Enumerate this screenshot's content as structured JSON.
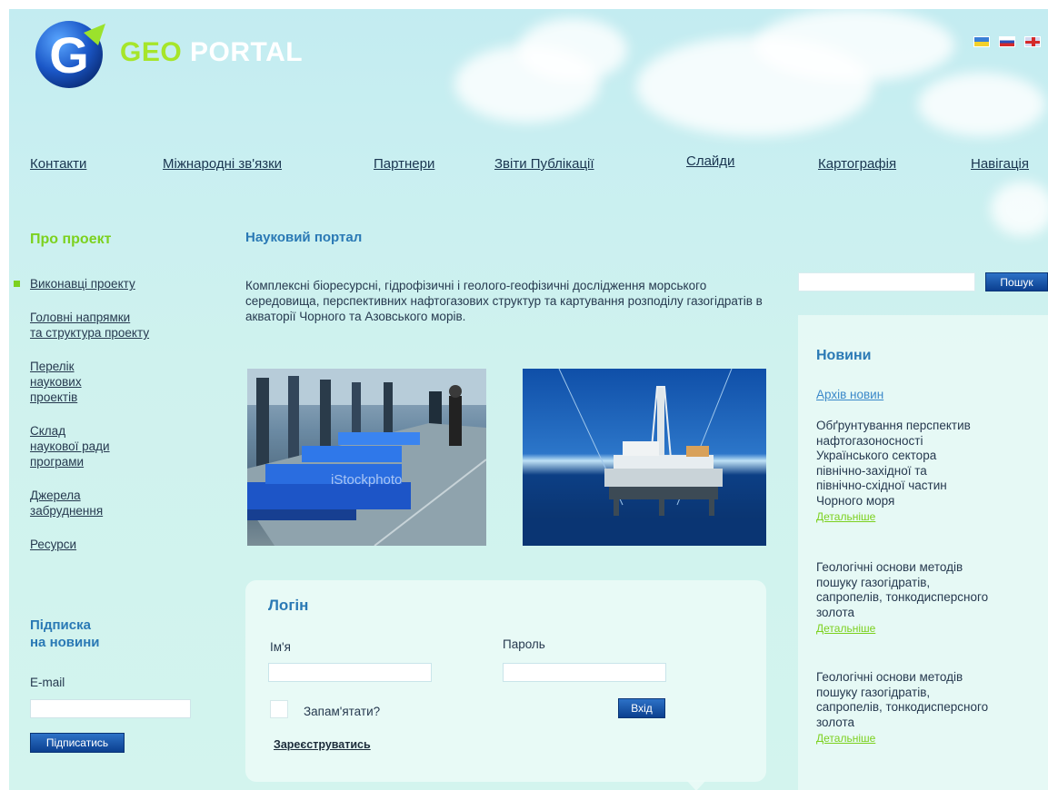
{
  "header": {
    "logo_text_accent": "GEO",
    "logo_text_rest": "PORTAL",
    "logo_letter": "G",
    "languages": [
      {
        "code": "uk",
        "icon": "flag-ukraine-icon"
      },
      {
        "code": "ru",
        "icon": "flag-russia-icon"
      },
      {
        "code": "en",
        "icon": "flag-uk-icon"
      }
    ]
  },
  "nav": {
    "items": [
      "Контакти",
      "Міжнародні зв'язки",
      "Партнери",
      "Звіти Публікації",
      "Слайди",
      "Картографія",
      "Навігація"
    ]
  },
  "sidebar": {
    "heading": "Про проект",
    "items": [
      "Виконавці проекту",
      "Головні напрямки\nта структура проекту",
      "Перелік\nнаукових\nпроектів",
      "Склад\nнаукової ради\nпрограми",
      "Джерела\nзабруднення",
      "Ресурси"
    ]
  },
  "subscribe": {
    "title": "Підписка\nна новини",
    "email_label": "E-mail",
    "button": "Підписатись"
  },
  "main": {
    "title": "Науковий портал",
    "intro": "Комплексні біоресурсні, гідрофізичні і геолого-геофізичні дослідження морського середовища, перспективних нафтогазових структур та картування розподілу газогідратів в акваторії Чорного та Азовського морів.",
    "photo_watermark": "iStockphoto"
  },
  "login": {
    "title": "Логін",
    "name_label": "Ім'я",
    "password_label": "Пароль",
    "remember_label": "Запам'ятати?",
    "submit": "Вхід",
    "register": "Зареєструватись"
  },
  "search": {
    "button": "Пошук",
    "value": ""
  },
  "news": {
    "heading": "Новини",
    "archive": "Архів новин",
    "items": [
      {
        "text": "Обґрунтування перспектив\nнафтогазоносності\nУкраїнського сектора\nпівнічно-західної та\nпівнічно-східної частин\nЧорного моря",
        "more": "Детальніше"
      },
      {
        "text": "Геологічні основи методів\nпошуку газогідратів,\nсапропелів, тонкодисперсного\nзолота",
        "more": "Детальніше"
      },
      {
        "text": "Геологічні основи методів\nпошуку газогідратів,\nсапропелів, тонкодисперсного\nзолота",
        "more": "Детальніше"
      }
    ]
  },
  "colors": {
    "accent_green": "#7cd11f",
    "heading_blue": "#2a79b5",
    "button_blue": "#0b3f8f",
    "sky": "#c9eff1"
  }
}
